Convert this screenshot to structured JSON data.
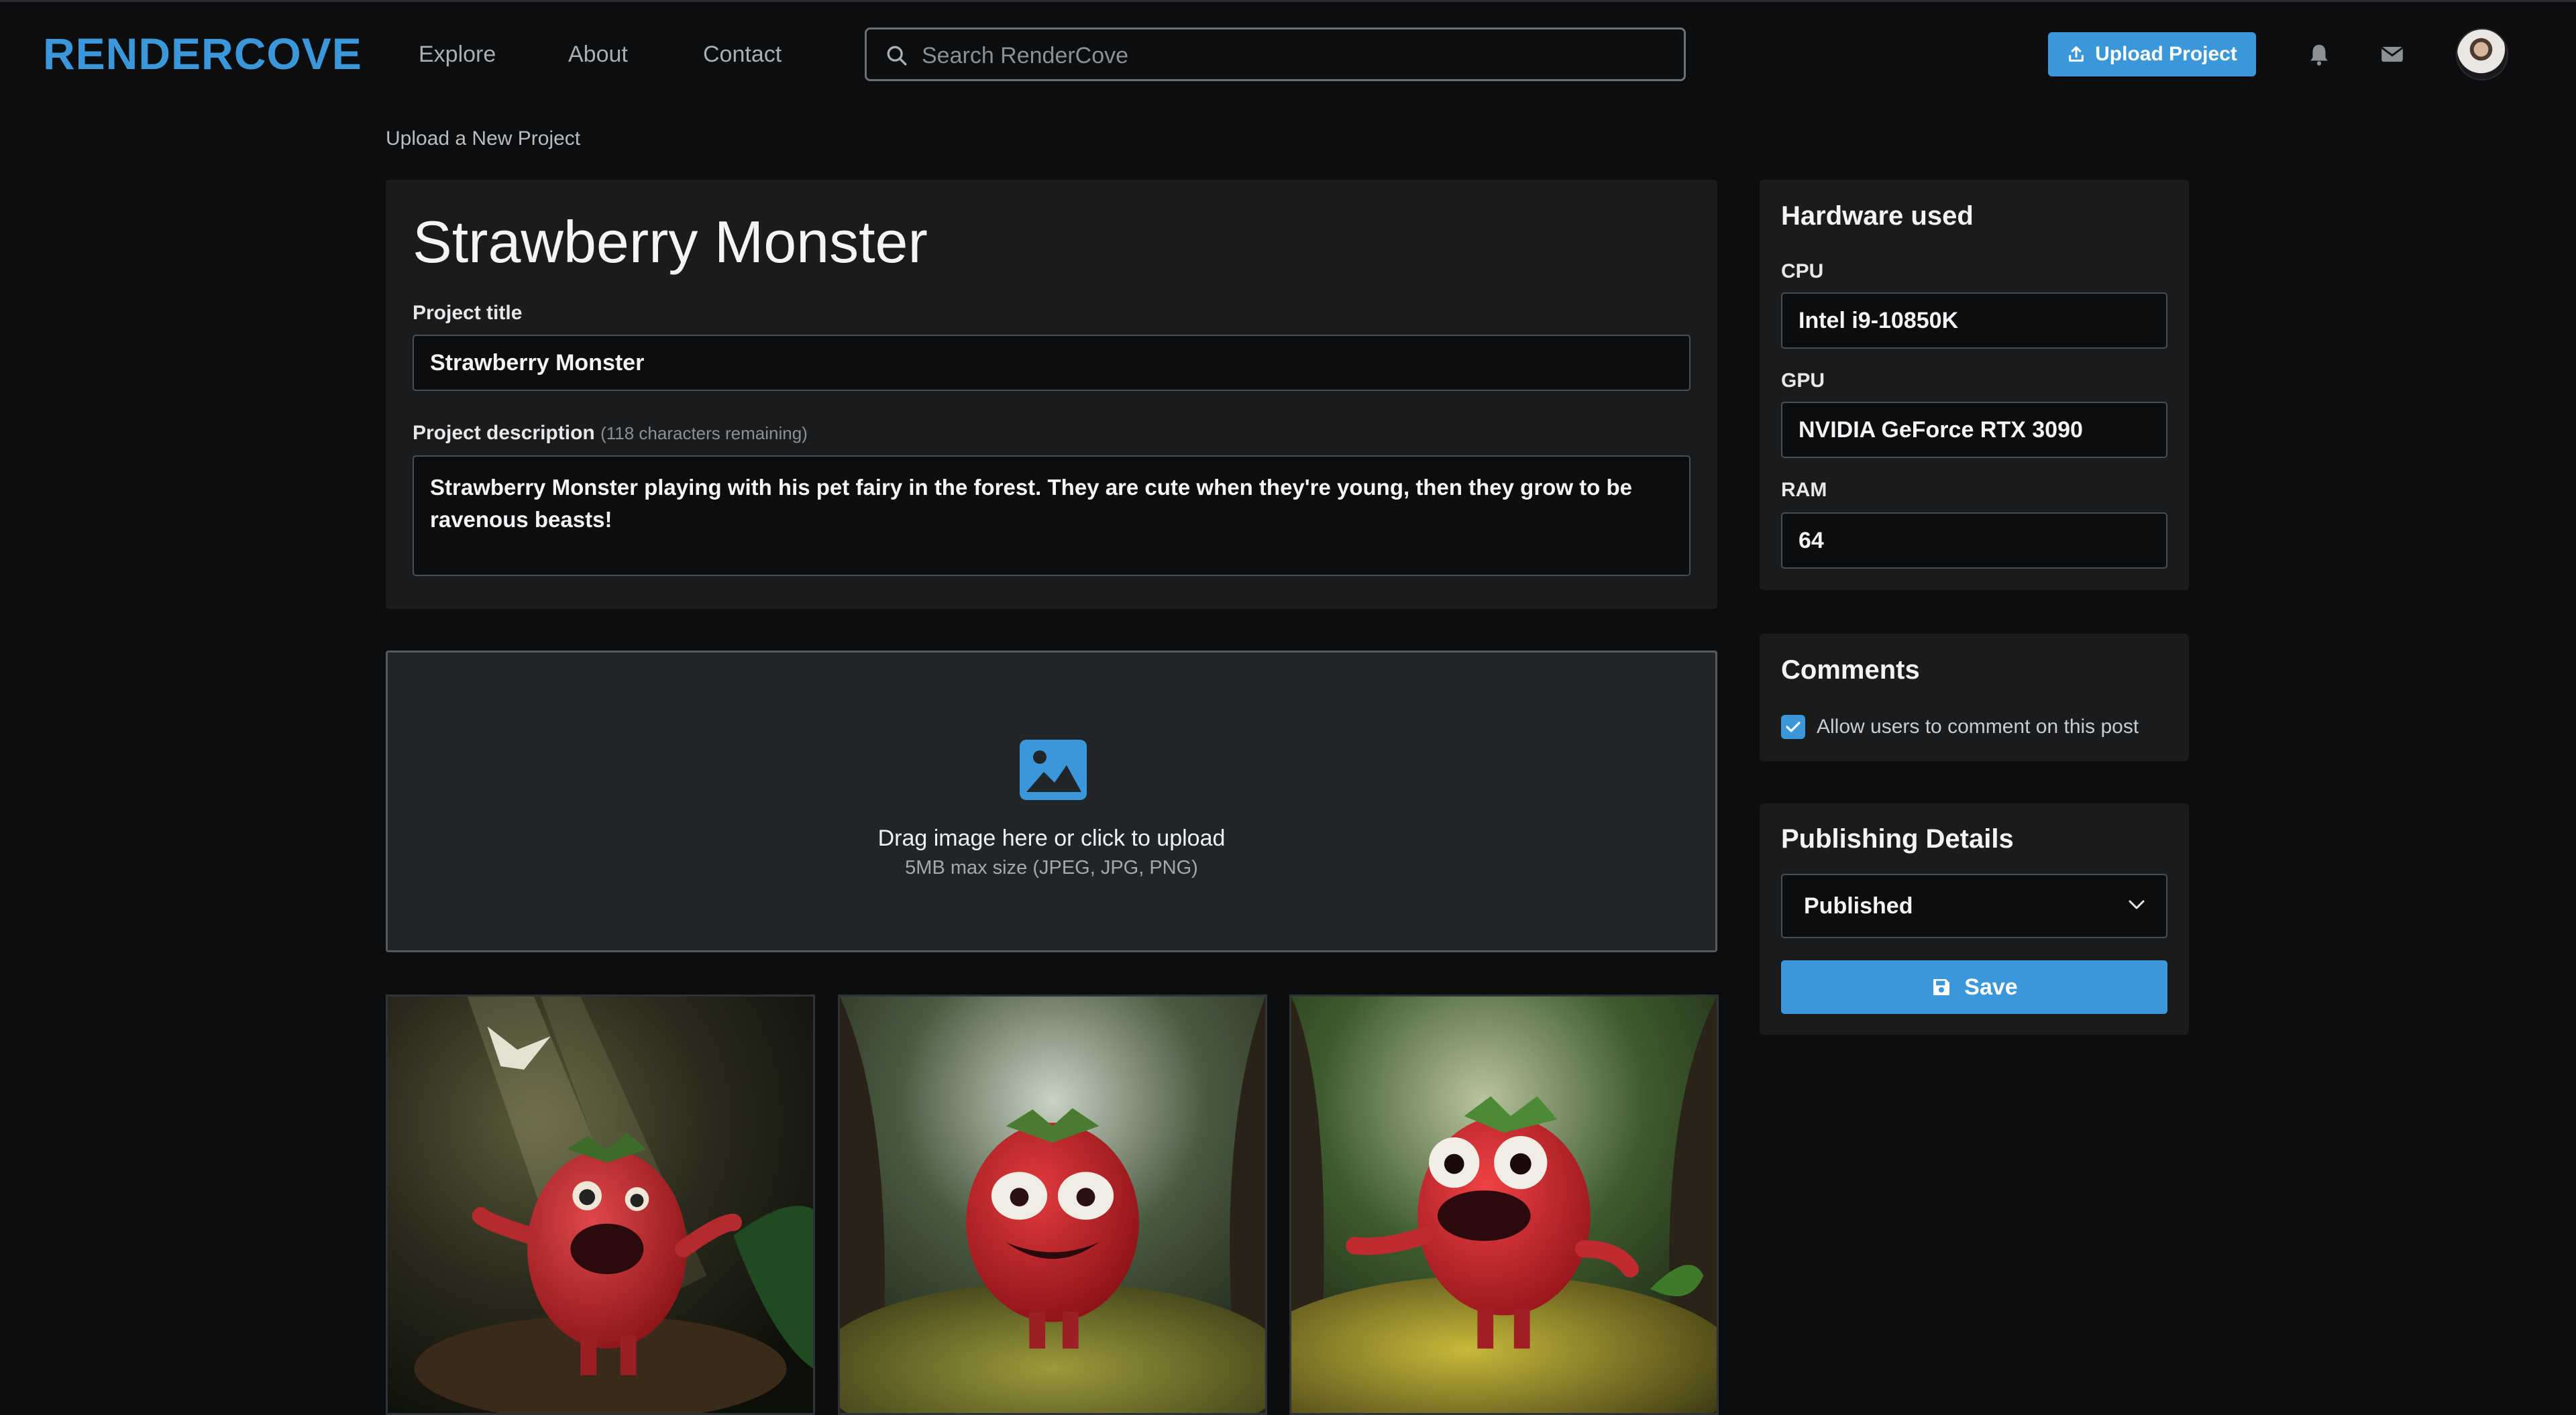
{
  "header": {
    "logo": "RENDERCOVE",
    "nav": [
      "Explore",
      "About",
      "Contact"
    ],
    "search_placeholder": "Search RenderCove",
    "upload_label": "Upload Project"
  },
  "breadcrumb": "Upload a New Project",
  "form": {
    "heading": "Strawberry Monster",
    "title_label": "Project title",
    "title_value": "Strawberry Monster",
    "description_label": "Project description",
    "description_hint": "(118 characters remaining)",
    "description_value": "Strawberry Monster playing with his pet fairy in the forest. They are cute when they're young, then they grow to be ravenous beasts!"
  },
  "upload": {
    "main": "Drag image here or click to upload",
    "sub": "5MB max size (JPEG, JPG, PNG)"
  },
  "hardware": {
    "heading": "Hardware used",
    "cpu_label": "CPU",
    "cpu_value": "Intel i9-10850K",
    "gpu_label": "GPU",
    "gpu_value": "NVIDIA GeForce RTX 3090",
    "ram_label": "RAM",
    "ram_value": "64"
  },
  "comments": {
    "heading": "Comments",
    "allow_label": "Allow users to comment on this post",
    "allow_checked": true
  },
  "publishing": {
    "heading": "Publishing Details",
    "status": "Published",
    "save_label": "Save"
  },
  "colors": {
    "accent": "#3a97da",
    "background": "#0c0d0f",
    "panel": "#1a1b1d"
  }
}
